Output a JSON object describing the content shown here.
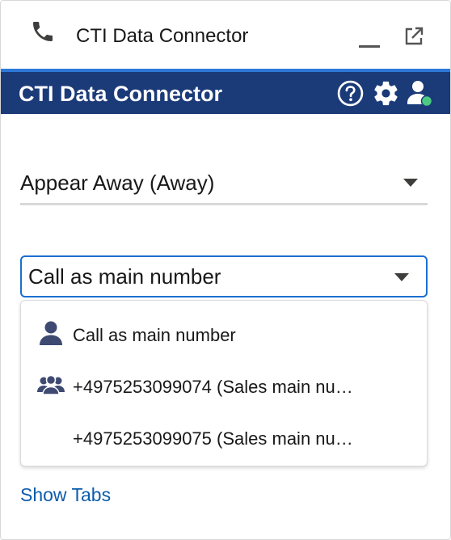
{
  "utility_bar": {
    "title": "CTI Data Connector",
    "icons": {
      "phone": "phone-icon",
      "minimize": "minimize-icon",
      "popout": "popout-icon"
    }
  },
  "app_bar": {
    "title": "CTI Data Connector",
    "icons": {
      "help": "help-icon",
      "settings": "gear-icon",
      "user": "user-status-icon"
    },
    "colors": {
      "background": "#1b3a78",
      "accent": "#2e7ad8",
      "status_dot": "#4bca81"
    }
  },
  "presence_status": {
    "selected": "Appear Away (Away)"
  },
  "outbound_number": {
    "selected": "Call as main number",
    "options": [
      {
        "label": "Call as main number",
        "icon": "user-icon"
      },
      {
        "label": "+4975253099074 (Sales main nu…",
        "icon": "group-icon"
      },
      {
        "label": "+4975253099075 (Sales main nu…",
        "icon": ""
      }
    ]
  },
  "links": {
    "show_tabs": "Show Tabs"
  }
}
